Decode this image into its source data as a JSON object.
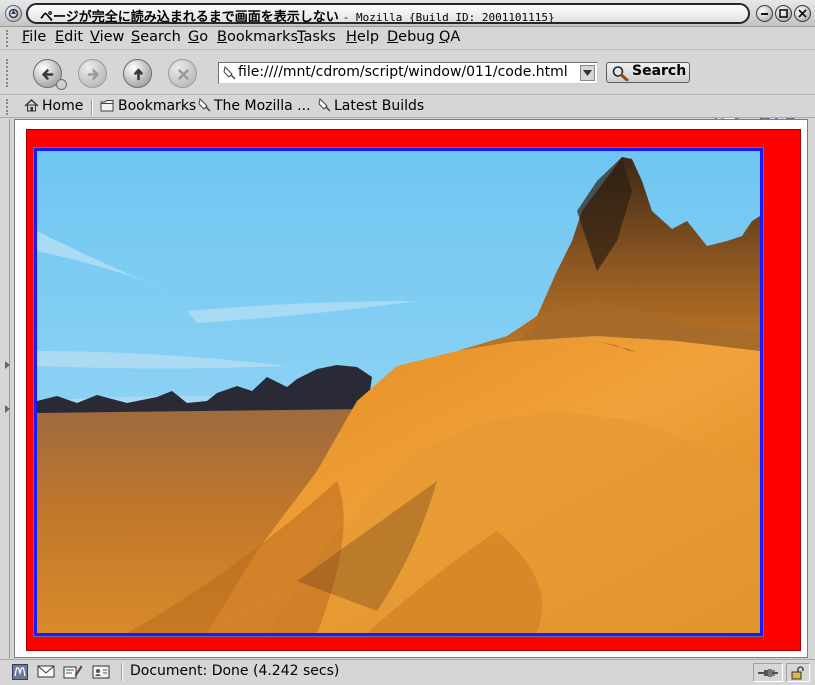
{
  "window": {
    "title": "ページが完全に読み込まれるまで画面を表示しない",
    "subtitle": "- Mozilla {Build ID: 2001101115}"
  },
  "menubar": {
    "items": [
      {
        "label": "File",
        "key": "F",
        "rest": "ile"
      },
      {
        "label": "Edit",
        "key": "E",
        "rest": "dit"
      },
      {
        "label": "View",
        "key": "V",
        "rest": "iew"
      },
      {
        "label": "Search",
        "key": "S",
        "rest": "earch"
      },
      {
        "label": "Go",
        "key": "G",
        "rest": "o"
      },
      {
        "label": "Bookmarks",
        "key": "B",
        "rest": "ookmarks"
      },
      {
        "label": "Tasks",
        "key": "T",
        "rest": "asks"
      },
      {
        "label": "Help",
        "key": "H",
        "rest": "elp"
      },
      {
        "label": "Debug",
        "key": "D",
        "rest": "ebug"
      },
      {
        "label": "QA",
        "key": "Q",
        "rest": "A"
      }
    ]
  },
  "navbar": {
    "url": "file:////mnt/cdrom/script/window/011/code.html",
    "search_label": "Search"
  },
  "personal_toolbar": {
    "home": "Home",
    "bookmarks": "Bookmarks",
    "mozilla": "The Mozilla ...",
    "latest": "Latest Builds"
  },
  "status": {
    "text": "Document: Done (4.242 secs)"
  },
  "colors": {
    "page_background": "#ff0000",
    "image_border": "#1a1aff"
  }
}
